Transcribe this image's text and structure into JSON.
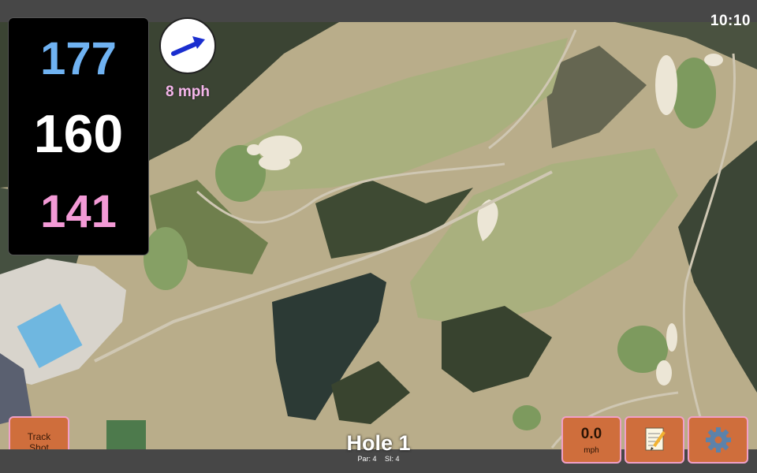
{
  "status": {
    "time": "10:10"
  },
  "distances": {
    "back": "177",
    "middle": "160",
    "front": "141"
  },
  "wind": {
    "speed": "8 mph",
    "direction_icon": "wind-arrow-icon"
  },
  "hole": {
    "title": "Hole 1",
    "par": "Par: 4",
    "si": "SI: 4"
  },
  "buttons": {
    "track_line1": "Track",
    "track_line2": "Shot",
    "speed_value": "0.0",
    "speed_unit": "mph",
    "notes_icon": "notepad-icon",
    "settings_icon": "gear-icon"
  },
  "colors": {
    "back_distance": "#6fb2f2",
    "middle_distance": "#ffffff",
    "front_distance": "#f39ad6",
    "button_fill": "#cf6e3c",
    "button_border": "#f0a0c8"
  }
}
